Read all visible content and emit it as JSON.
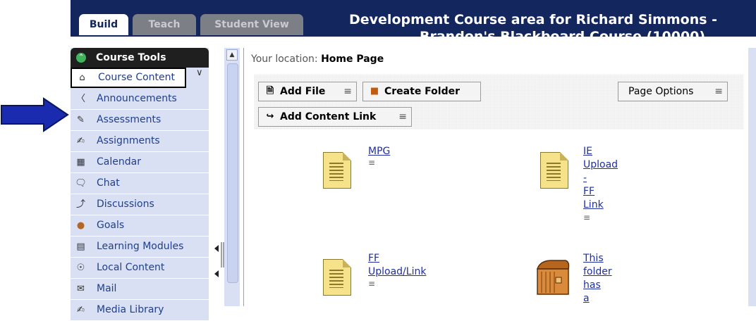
{
  "tabs": [
    {
      "label": "Build",
      "active": true
    },
    {
      "label": "Teach",
      "active": false
    },
    {
      "label": "Student View",
      "active": false
    }
  ],
  "course_title_line1": "Development Course area for Richard Simmons -",
  "course_title_line2": "Brandon's Blackboard Course (10000)",
  "sidebar": {
    "header": "Course Tools",
    "items": [
      {
        "label": "Course Content",
        "icon": "home-icon",
        "selected": true
      },
      {
        "label": "Announcements",
        "icon": "megaphone-icon"
      },
      {
        "label": "Assessments",
        "icon": "assessment-icon"
      },
      {
        "label": "Assignments",
        "icon": "assignment-icon"
      },
      {
        "label": "Calendar",
        "icon": "calendar-icon"
      },
      {
        "label": "Chat",
        "icon": "chat-bubble-icon"
      },
      {
        "label": "Discussions",
        "icon": "discussion-pin-icon"
      },
      {
        "label": "Goals",
        "icon": "goals-icon"
      },
      {
        "label": "Learning Modules",
        "icon": "module-book-icon"
      },
      {
        "label": "Local Content",
        "icon": "local-disc-icon"
      },
      {
        "label": "Mail",
        "icon": "envelope-icon"
      },
      {
        "label": "Media Library",
        "icon": "media-library-icon"
      }
    ]
  },
  "location": {
    "prefix": "Your location:",
    "page": "Home Page"
  },
  "actions": {
    "add_file": "Add File",
    "create_folder": "Create Folder",
    "page_options": "Page Options",
    "add_content_link": "Add Content Link"
  },
  "content_items": [
    {
      "label": "MPG",
      "type": "file"
    },
    {
      "label": "IE\nUpload\n-\nFF\nLink",
      "type": "file"
    },
    {
      "label": "FF\nUpload/Link",
      "type": "file"
    },
    {
      "label": "This\nfolder\nhas\na",
      "type": "folder"
    }
  ],
  "colors": {
    "navy": "#13275e",
    "sidebar": "#d9e0f3",
    "link": "#1f2fa0",
    "arrow": "#1a2bb0"
  }
}
